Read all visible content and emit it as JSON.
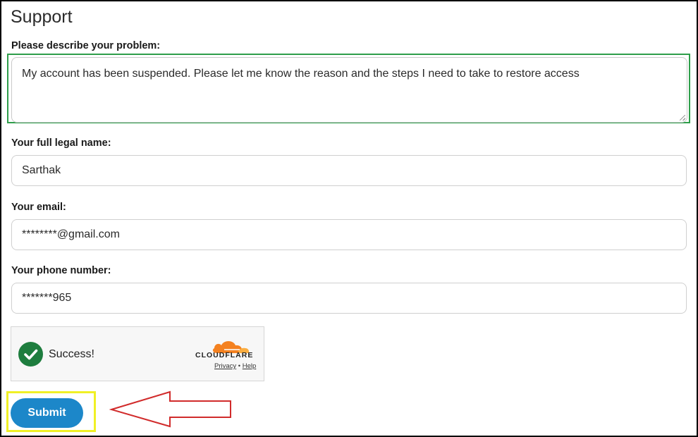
{
  "page": {
    "title": "Support"
  },
  "form": {
    "problem_label": "Please describe your problem:",
    "problem_value": "My account has been suspended. Please let me know the reason and the steps I need to take to restore access",
    "name_label": "Your full legal name:",
    "name_value": "Sarthak",
    "email_label": "Your email:",
    "email_value": "********@gmail.com",
    "phone_label": "Your phone number:",
    "phone_value": "*******965",
    "submit_label": "Submit"
  },
  "captcha": {
    "status_text": "Success!",
    "brand": "CLOUDFLARE",
    "privacy_link": "Privacy",
    "separator": "•",
    "help_link": "Help"
  },
  "colors": {
    "green_highlight": "#2e9e4a",
    "yellow_highlight": "#f0f025",
    "arrow": "#d12b2b",
    "submit_bg": "#1c87c9",
    "success_green": "#1e7d3e",
    "cloudflare_orange": "#f48120"
  },
  "icons": {
    "success": "check-circle-icon",
    "cloudflare": "cloudflare-cloud-icon",
    "annotation": "left-arrow-icon"
  }
}
